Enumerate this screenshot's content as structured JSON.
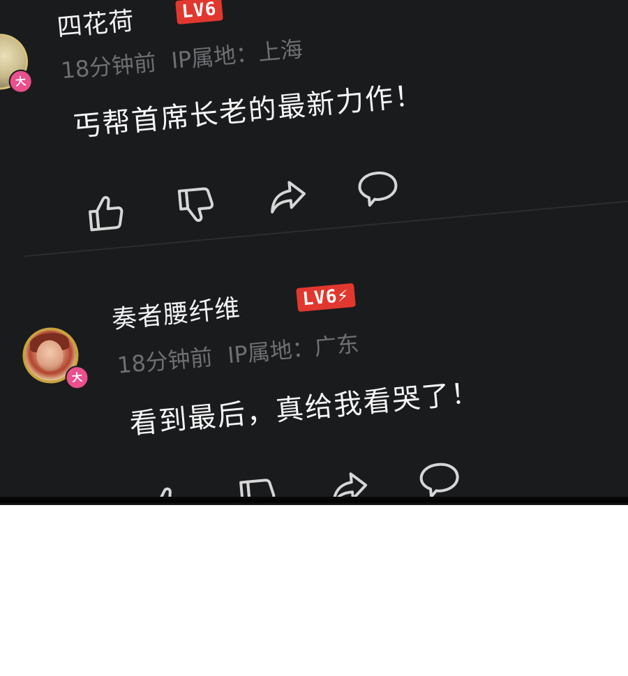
{
  "comments": [
    {
      "username": "四花荷",
      "level": "LV6",
      "badge": "大",
      "time": "18分钟前",
      "ip_location": "IP属地：上海",
      "content": "丐帮首席长老的最新力作！",
      "actions": [
        "like-icon",
        "dislike-icon",
        "share-icon",
        "reply-icon"
      ]
    },
    {
      "username": "奏者腰纤维",
      "level": "LV6⚡",
      "badge": "大",
      "time": "18分钟前",
      "ip_location": "IP属地：广东",
      "content": "看到最后，真给我看哭了！",
      "actions": [
        "like-icon",
        "dislike-icon",
        "share-icon",
        "reply-icon"
      ]
    }
  ],
  "colors": {
    "background": "#1a1b1d",
    "username": "#f2f2f2",
    "meta": "#6e6f72",
    "level_badge": "#e0382f",
    "da_badge": "#ea4f8e",
    "icon_stroke": "#d6d6d6"
  }
}
